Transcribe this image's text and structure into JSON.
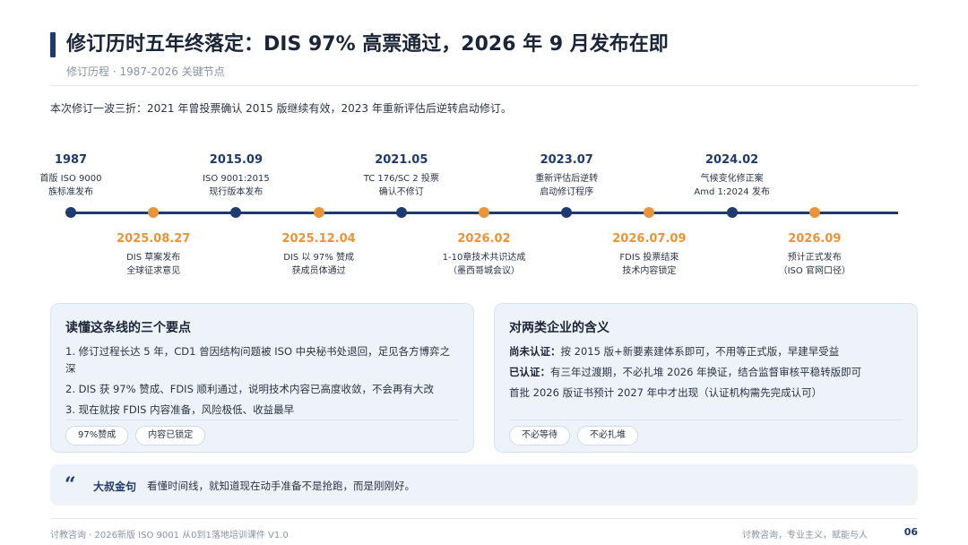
{
  "header": {
    "title": "修订历时五年终落定：DIS 97% 高票通过，2026 年 9 月发布在即",
    "subtitle": "修订历程 · 1987-2026 关键节点"
  },
  "intro": "本次修订一波三折：2021 年曾投票确认 2015 版继续有效，2023 年重新评估后逆转启动修订。",
  "timeline": {
    "colors": {
      "line": "#1e3a6e",
      "upper": "#1e3a6e",
      "lower": "#e8943a"
    },
    "events": [
      {
        "date": "1987",
        "desc": "首版 ISO 9000\n族标准发布",
        "position": "top"
      },
      {
        "date": "2025.08.27",
        "desc": "DIS 草案发布\n全球征求意见",
        "position": "bottom"
      },
      {
        "date": "2015.09",
        "desc": "ISO 9001:2015\n现行版本发布",
        "position": "top"
      },
      {
        "date": "2025.12.04",
        "desc": "DIS 以 97% 赞成\n获成员体通过",
        "position": "bottom"
      },
      {
        "date": "2021.05",
        "desc": "TC 176/SC 2 投票\n确认不修订",
        "position": "top"
      },
      {
        "date": "2026.02",
        "desc": "1-10章技术共识达成\n（墨西哥城会议）",
        "position": "bottom"
      },
      {
        "date": "2023.07",
        "desc": "重新评估后逆转\n启动修订程序",
        "position": "top"
      },
      {
        "date": "2026.07.09",
        "desc": "FDIS 投票结束\n技术内容锁定",
        "position": "bottom"
      },
      {
        "date": "2024.02",
        "desc": "气候变化修正案\nAmd 1:2024 发布",
        "position": "top"
      },
      {
        "date": "2026.09",
        "desc": "预计正式发布\n（ISO 官网口径）",
        "position": "bottom"
      }
    ]
  },
  "card_left": {
    "title": "读懂这条线的三个要点",
    "items": [
      "1. 修订过程长达 5 年，CD1 曾因结构问题被 ISO 中央秘书处退回，足见各方博弈之深",
      "2. DIS 获 97% 赞成、FDIS 顺利通过，说明技术内容已高度收敛，不会再有大改",
      "3. 现在就按 FDIS 内容准备，风险极低、收益最早"
    ],
    "tags": [
      "97%赞成",
      "内容已锁定"
    ]
  },
  "card_right": {
    "title": "对两类企业的含义",
    "rows": [
      {
        "label": "尚未认证：",
        "text": "按 2015 版+新要素建体系即可，不用等正式版，早建早受益"
      },
      {
        "label": "已认证：",
        "text": "有三年过渡期，不必扎堆 2026 年换证，结合监督审核平稳转版即可"
      },
      {
        "label": "",
        "text": "首批 2026 版证书预计 2027 年中才出现（认证机构需先完成认可）"
      }
    ],
    "tags": [
      "不必等待",
      "不必扎堆"
    ]
  },
  "quote": {
    "icon": "quote-icon",
    "label": "大叔金句",
    "text": "看懂时间线，就知道现在动手准备不是抢跑，而是刚刚好。"
  },
  "footer": {
    "left": "讨教咨询 · 2026新版 ISO 9001 从0到1落地培训课件 V1.0",
    "right": "讨教咨询，专业主义，赋能与人",
    "page": "06"
  }
}
